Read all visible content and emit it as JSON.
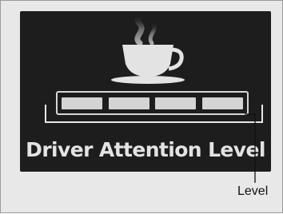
{
  "display": {
    "title": "Driver Attention Level",
    "icon": "coffee-cup-icon",
    "meter_level_fraction": 1.0,
    "meter_segments_total": 4,
    "meter_segments_filled": 4
  },
  "callout": {
    "label": "Level"
  },
  "colors": {
    "screen_background": "#1d1d1d",
    "text_and_icon": "#e3e3e3",
    "frame_background": "#e8e8e8"
  }
}
